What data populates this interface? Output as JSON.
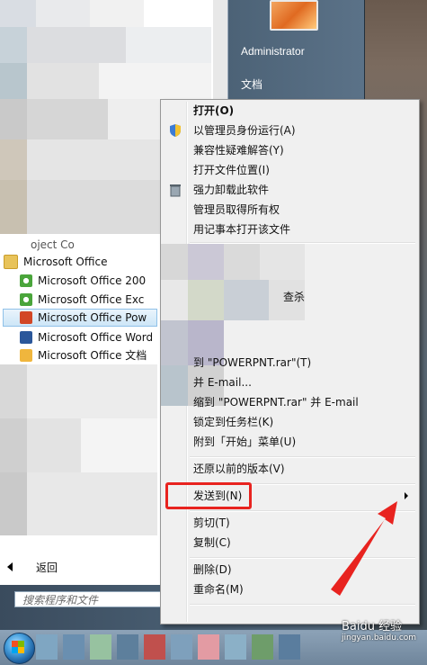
{
  "start_menu": {
    "right_panel": {
      "user_name": "Administrator",
      "documents": "文档"
    },
    "programs": {
      "truncated_above": "oject Co",
      "folder": "Microsoft Office",
      "items": [
        {
          "label": "Microsoft Office 200",
          "icon": "office-clip-icon"
        },
        {
          "label": "Microsoft Office Exc",
          "icon": "excel-icon"
        },
        {
          "label": "Microsoft Office Pow",
          "icon": "powerpoint-icon",
          "selected": true
        },
        {
          "label": "Microsoft Office Word",
          "icon": "word-icon"
        },
        {
          "label": "Microsoft Office 文档",
          "icon": "office-doc-icon"
        }
      ]
    },
    "back_label": "返回",
    "search_placeholder": "搜索程序和文件"
  },
  "context_menu": {
    "items": [
      {
        "label": "打开(O)",
        "bold": true
      },
      {
        "label": "以管理员身份运行(A)",
        "icon": "uac-shield-icon"
      },
      {
        "label": "兼容性疑难解答(Y)"
      },
      {
        "label": "打开文件位置(I)"
      },
      {
        "label": "强力卸载此软件",
        "icon": "trash-icon"
      },
      {
        "label": "管理员取得所有权"
      },
      {
        "label": "用记事本打开该文件"
      },
      {
        "label": "查杀"
      },
      {
        "label": "到 \"POWERPNT.rar\"(T)"
      },
      {
        "label": "并 E-mail..."
      },
      {
        "label": "缩到 \"POWERPNT.rar\" 并 E-mail"
      },
      {
        "label": "锁定到任务栏(K)"
      },
      {
        "label": "附到「开始」菜单(U)"
      },
      {
        "label": "还原以前的版本(V)"
      },
      {
        "label": "发送到(N)"
      },
      {
        "label": "剪切(T)"
      },
      {
        "label": "复制(C)"
      },
      {
        "label": "删除(D)"
      },
      {
        "label": "重命名(M)"
      }
    ]
  },
  "watermark": {
    "text": "Baidu 经验",
    "url": "jingyan.baidu.com"
  },
  "colors": {
    "highlight": "#e8231f",
    "selection": "#cde6f7",
    "menu_bg": "#f0f0f0"
  }
}
